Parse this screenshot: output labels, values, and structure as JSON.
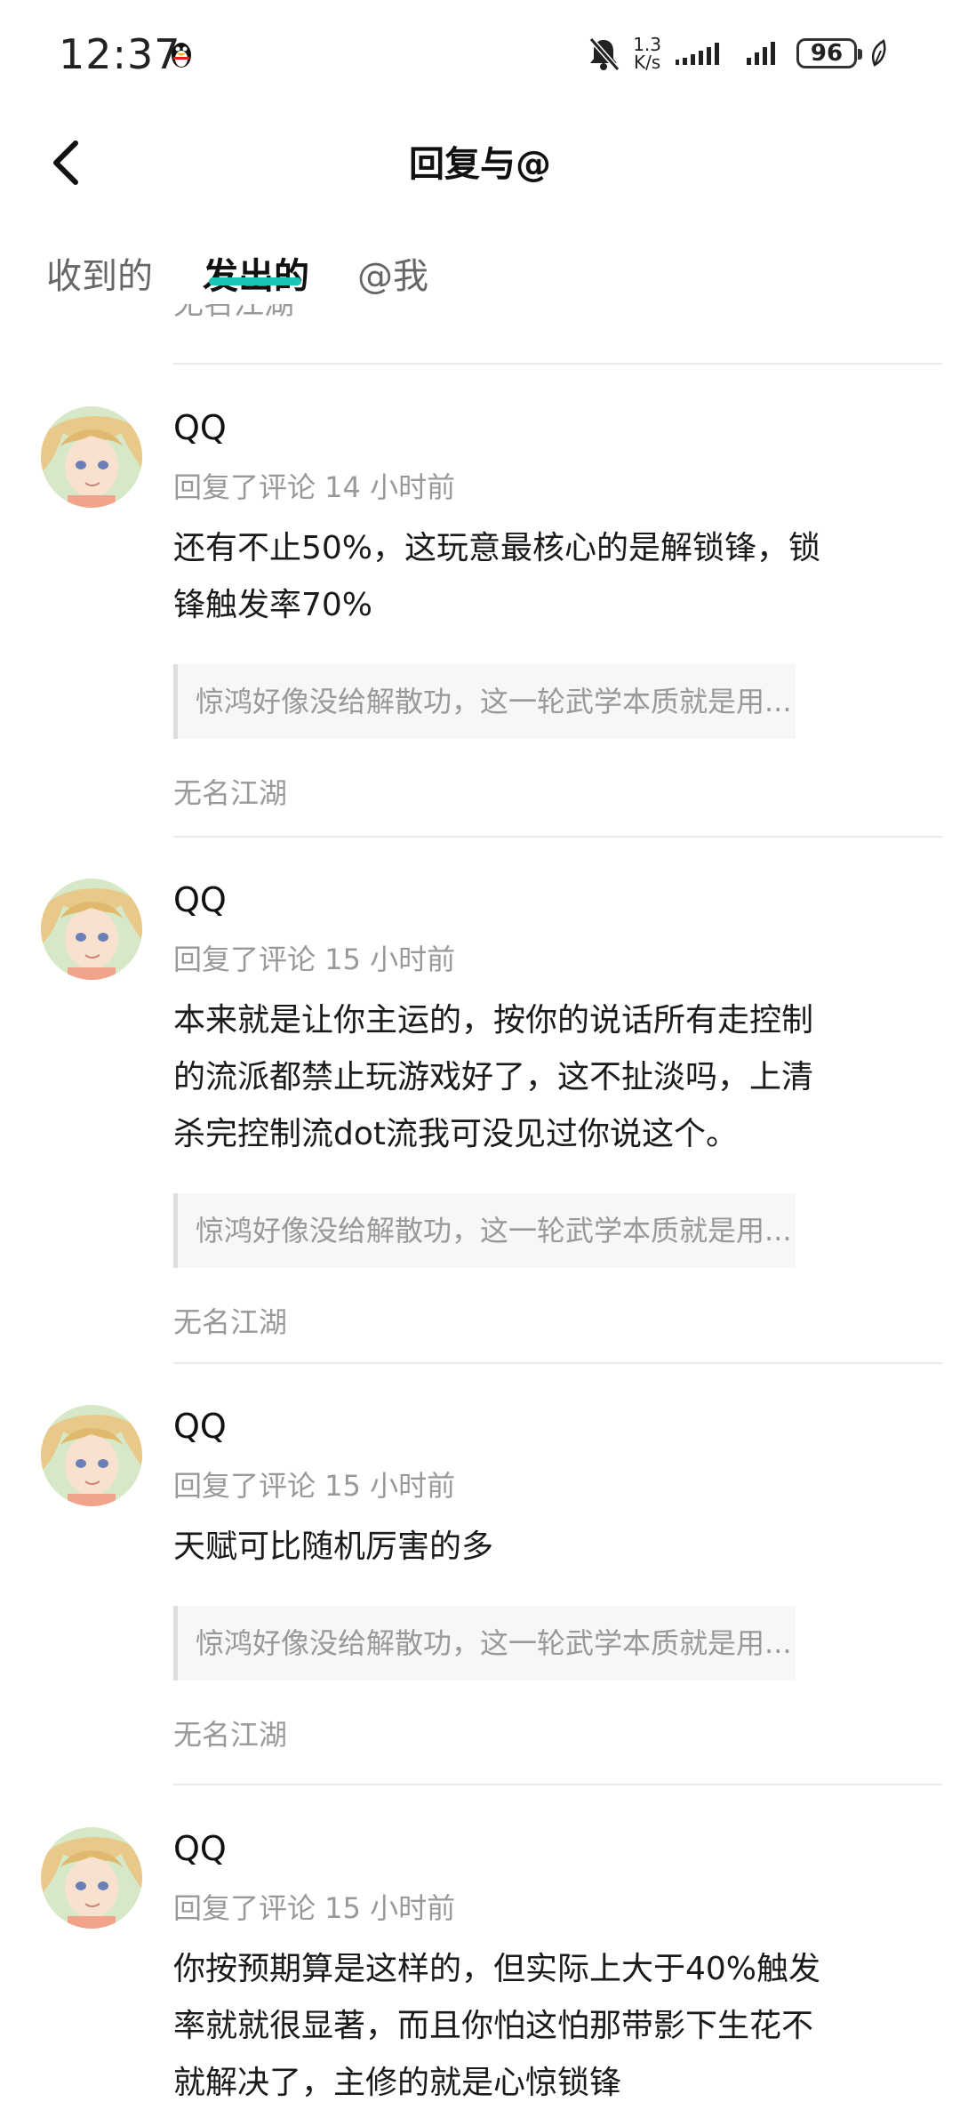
{
  "status": {
    "time": "12:37",
    "net_speed_value": "1.3",
    "net_speed_unit": "K/s",
    "battery": "96"
  },
  "header": {
    "title": "回复与@"
  },
  "tabs": [
    {
      "label": "收到的",
      "active": false
    },
    {
      "label": "发出的",
      "active": true
    },
    {
      "label": "@我",
      "active": false
    }
  ],
  "feed": {
    "cut_source": "无名江湖",
    "items": [
      {
        "user": "QQ",
        "meta": "回复了评论 14 小时前",
        "text": "还有不止50%，这玩意最核心的是解锁锋，锁\n锋触发率70%",
        "quote": "惊鸿好像没给解散功，这一轮武学本质就是用...",
        "source": "无名江湖"
      },
      {
        "user": "QQ",
        "meta": "回复了评论 15 小时前",
        "text": "本来就是让你主运的，按你的说话所有走控制\n的流派都禁止玩游戏好了，这不扯淡吗，上清\n杀完控制流dot流我可没见过你说这个。",
        "quote": "惊鸿好像没给解散功，这一轮武学本质就是用...",
        "source": "无名江湖"
      },
      {
        "user": "QQ",
        "meta": "回复了评论 15 小时前",
        "text": "天赋可比随机厉害的多",
        "quote": "惊鸿好像没给解散功，这一轮武学本质就是用...",
        "source": "无名江湖"
      },
      {
        "user": "QQ",
        "meta": "回复了评论 15 小时前",
        "text": "你按预期算是这样的，但实际上大于40%触发\n率就就很显著，而且你怕这怕那带影下生花不\n就解决了，主修的就是心惊锁锋",
        "quote": "",
        "source": ""
      }
    ]
  },
  "colors": {
    "accent": "#1bc5b5",
    "muted_text": "#999999",
    "quote_bg": "#f6f7f9"
  },
  "icons": {
    "back": "chevron-left-icon",
    "mute": "bell-off-icon",
    "signal": "signal-icon",
    "battery": "battery-icon",
    "leaf": "leaf-icon"
  }
}
